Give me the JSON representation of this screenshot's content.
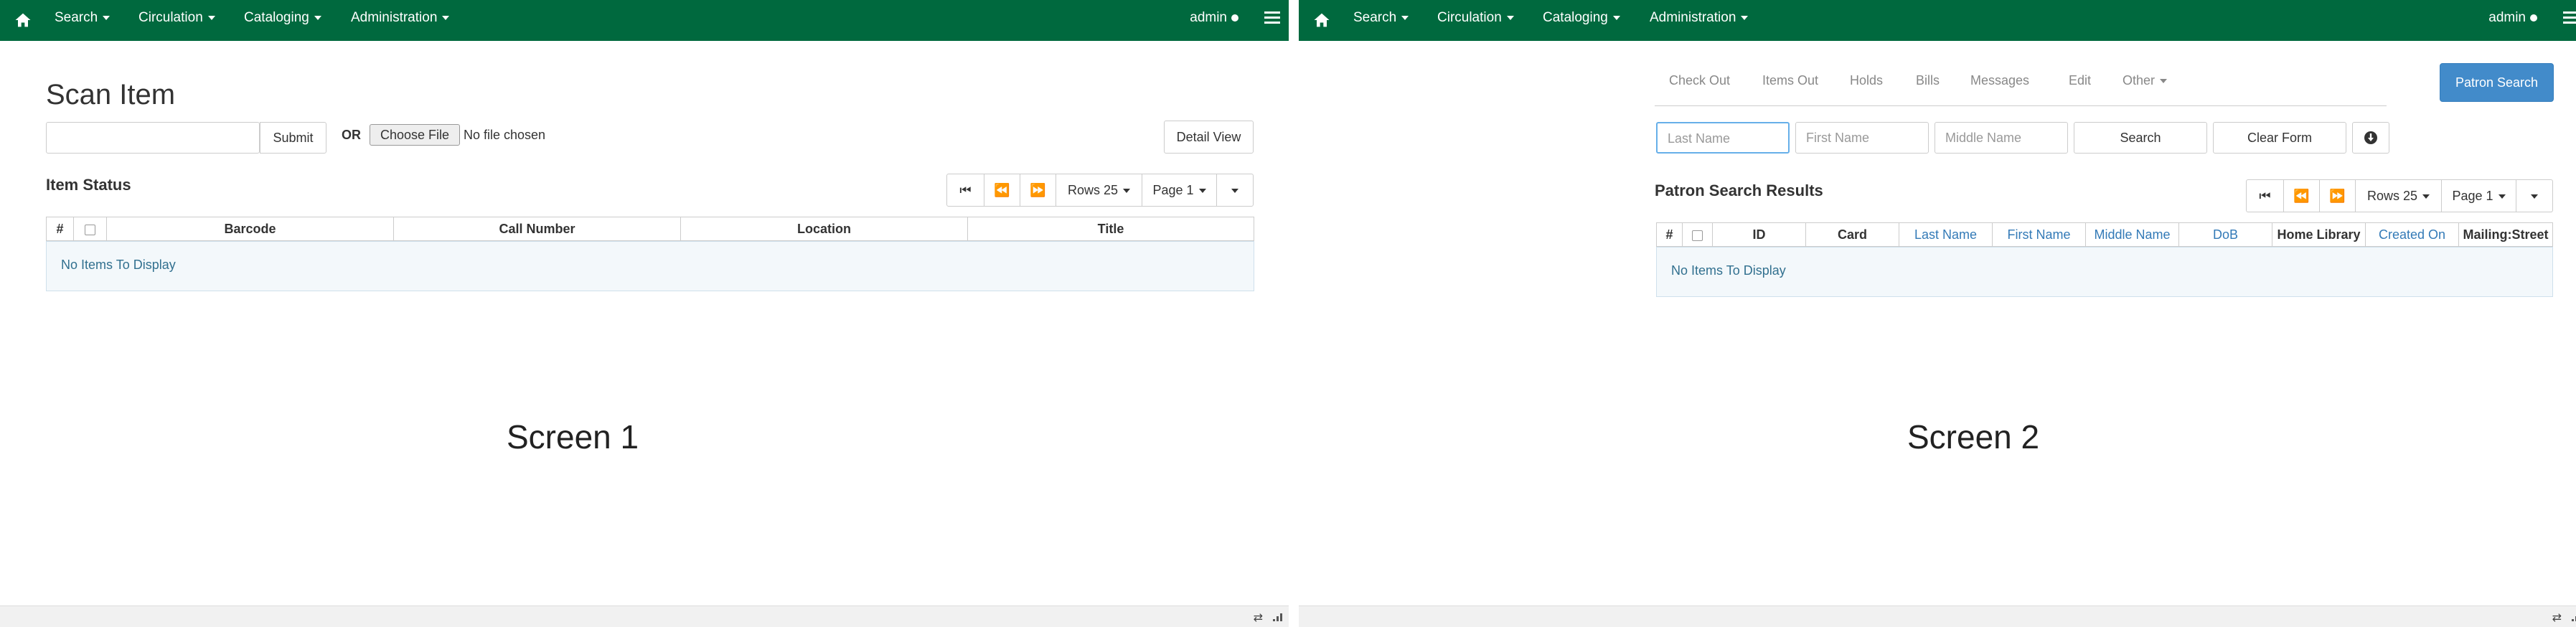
{
  "screen1": {
    "nav": {
      "search": "Search",
      "circulation": "Circulation",
      "cataloging": "Cataloging",
      "administration": "Administration",
      "admin": "admin"
    },
    "title": "Scan Item",
    "submit": "Submit",
    "or": "OR",
    "choose_file": "Choose File",
    "no_file": "No file chosen",
    "detail_view": "Detail View",
    "section": "Item Status",
    "rows": "Rows 25",
    "page": "Page 1",
    "columns": [
      "#",
      "",
      "Barcode",
      "Call Number",
      "Location",
      "Title"
    ],
    "empty": "No Items To Display",
    "label": "Screen  1"
  },
  "screen2": {
    "nav": {
      "search": "Search",
      "circulation": "Circulation",
      "cataloging": "Cataloging",
      "administration": "Administration",
      "admin": "admin"
    },
    "tabs": [
      "Check Out",
      "Items Out",
      "Holds",
      "Bills",
      "Messages",
      "Edit",
      "Other"
    ],
    "patron_search": "Patron Search",
    "last_name_ph": "Last Name",
    "first_name_ph": "First Name",
    "middle_name_ph": "Middle Name",
    "search": "Search",
    "clear_form": "Clear Form",
    "section": "Patron Search Results",
    "rows": "Rows 25",
    "page": "Page 1",
    "columns": [
      "#",
      "",
      "ID",
      "Card",
      "Last Name",
      "First Name",
      "Middle Name",
      "DoB",
      "Home Library",
      "Created On",
      "Mailing:Street"
    ],
    "empty": "No Items To Display",
    "label": "Screen  2"
  },
  "icons": [
    "home-icon",
    "menu-icon",
    "first-page-icon",
    "prev-page-icon",
    "next-page-icon",
    "caret-down-icon",
    "info-icon",
    "statusbar-arrows-icon",
    "resize-grip-icon"
  ]
}
